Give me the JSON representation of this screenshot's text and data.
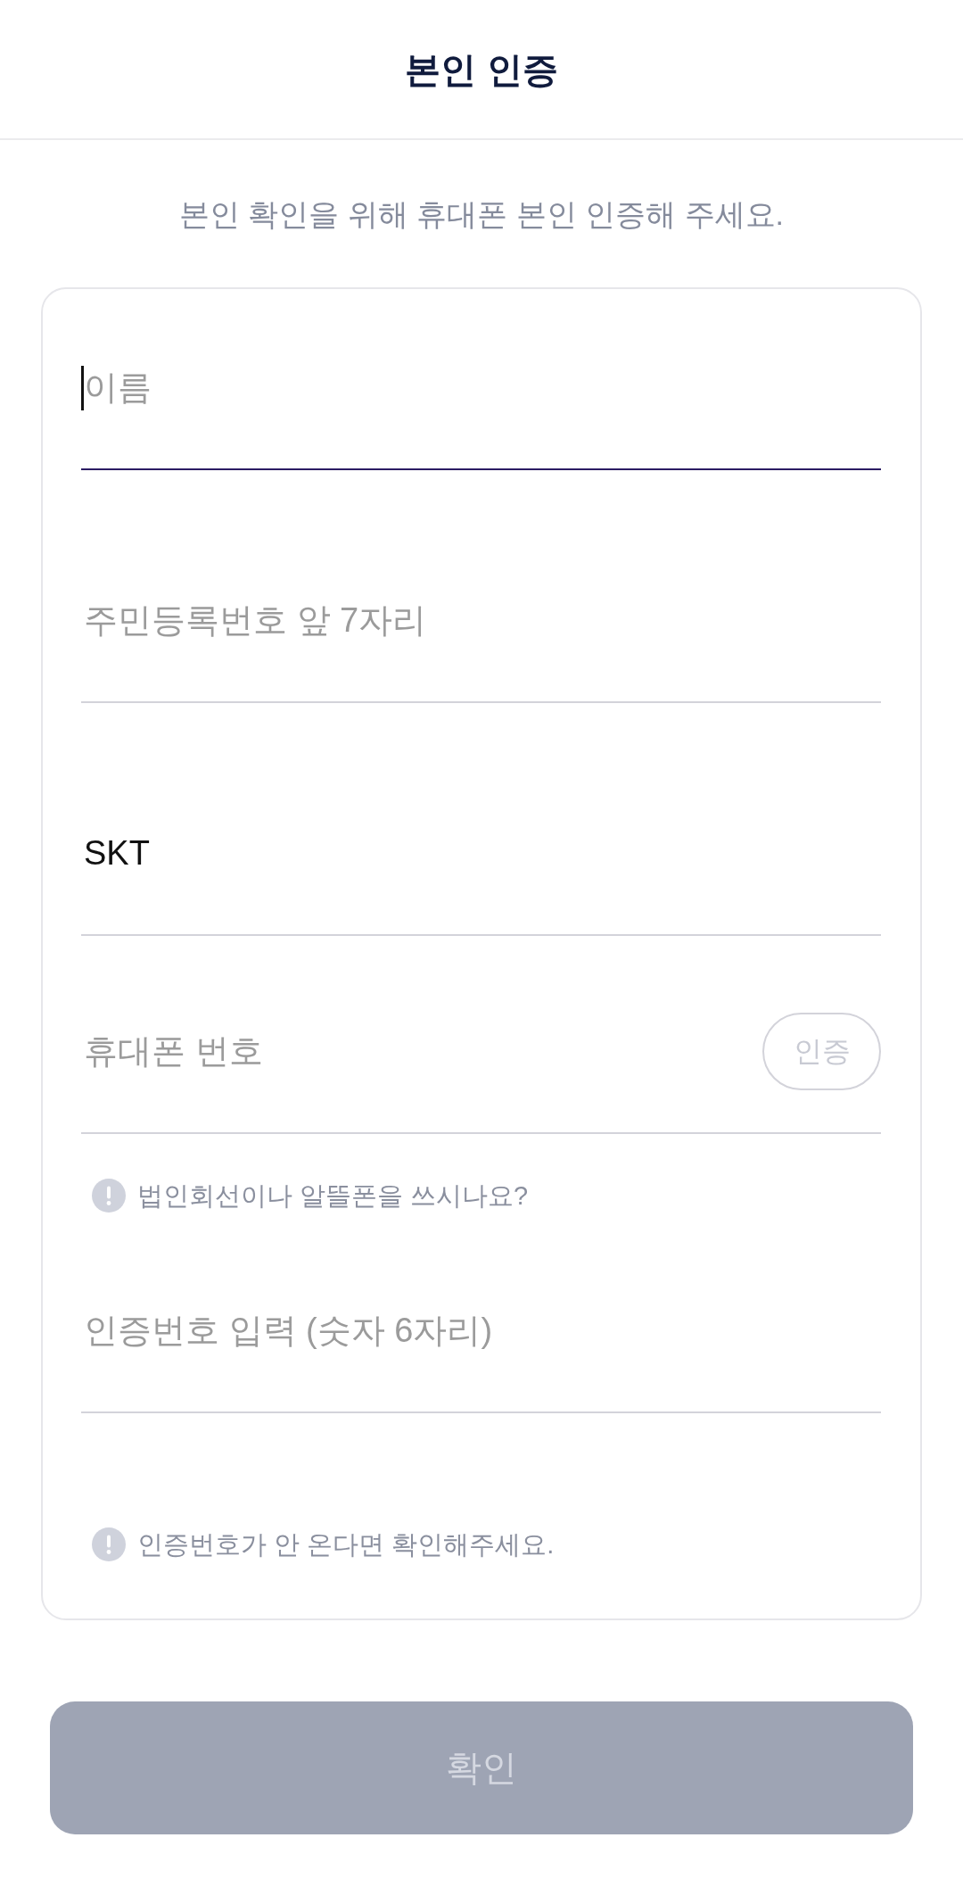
{
  "header": {
    "title": "본인 인증"
  },
  "intro": "본인 확인을 위해 휴대폰 본인 인증해 주세요.",
  "form": {
    "items": [
      {
        "kind": "field",
        "placeholder": "이름",
        "focused": true
      },
      {
        "kind": "field",
        "placeholder": "주민등록번호 앞 7자리",
        "focused": false
      },
      {
        "kind": "field",
        "value": "SKT",
        "focused": false
      },
      {
        "kind": "field",
        "placeholder": "휴대폰 번호",
        "focused": false,
        "action": {
          "label": "인증",
          "disabled": true
        }
      },
      {
        "kind": "hint",
        "text": "법인회선이나 알뜰폰을 쓰시나요?"
      },
      {
        "kind": "field",
        "placeholder": "인증번호 입력 (숫자 6자리)",
        "focused": false
      },
      {
        "kind": "hint",
        "text": "인증번호가 안 온다면 확인해주세요."
      }
    ]
  },
  "submit": {
    "label": "확인",
    "disabled": true
  }
}
